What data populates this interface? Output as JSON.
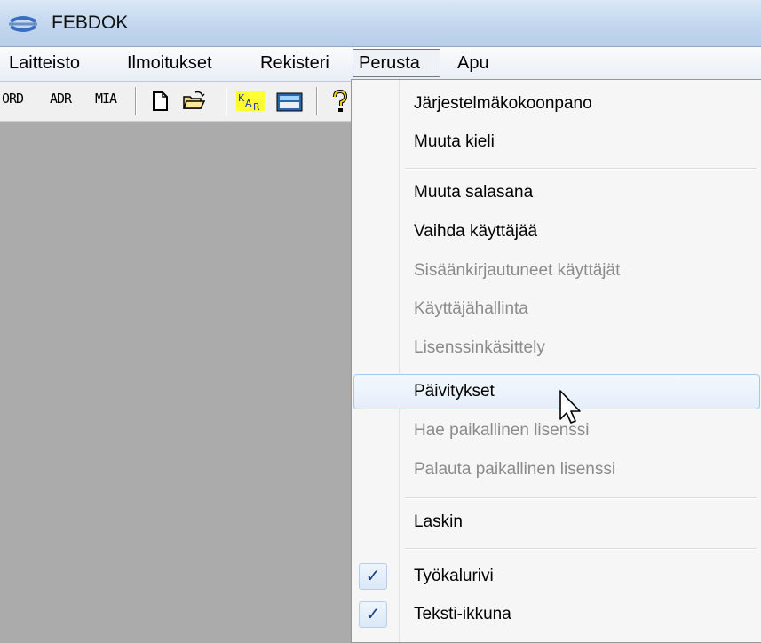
{
  "window": {
    "title": "FEBDOK",
    "icon": "febdok-app-icon"
  },
  "menubar": {
    "items": [
      {
        "label": "Laitteisto"
      },
      {
        "label": "Ilmoitukset"
      },
      {
        "label": "Rekisteri"
      },
      {
        "label": "Perusta",
        "active": true
      },
      {
        "label": "Apu"
      }
    ]
  },
  "toolbar": {
    "text_buttons": [
      "ORD",
      "ADR",
      "MIA"
    ],
    "icons": [
      "new-document-icon",
      "open-folder-icon",
      "kar-icon",
      "calculator-icon",
      "help-icon"
    ]
  },
  "dropdown": {
    "menu": "Perusta",
    "items": [
      {
        "label": "Järjestelmäkokoonpano",
        "enabled": true
      },
      {
        "label": "Muuta kieli",
        "enabled": true
      },
      {
        "label": "Muuta salasana",
        "enabled": true
      },
      {
        "label": "Vaihda käyttäjää",
        "enabled": true
      },
      {
        "label": "Sisäänkirjautuneet käyttäjät",
        "enabled": false
      },
      {
        "label": "Käyttäjähallinta",
        "enabled": false
      },
      {
        "label": "Lisenssinkäsittely",
        "enabled": false
      },
      {
        "label": "Päivitykset",
        "enabled": true,
        "highlighted": true
      },
      {
        "label": "Hae paikallinen lisenssi",
        "enabled": false
      },
      {
        "label": "Palauta paikallinen lisenssi",
        "enabled": false
      },
      {
        "label": "Laskin",
        "enabled": true
      },
      {
        "label": "Työkalurivi",
        "enabled": true,
        "checked": true
      },
      {
        "label": "Teksti-ikkuna",
        "enabled": true,
        "checked": true
      }
    ],
    "check_glyph": "✓"
  }
}
